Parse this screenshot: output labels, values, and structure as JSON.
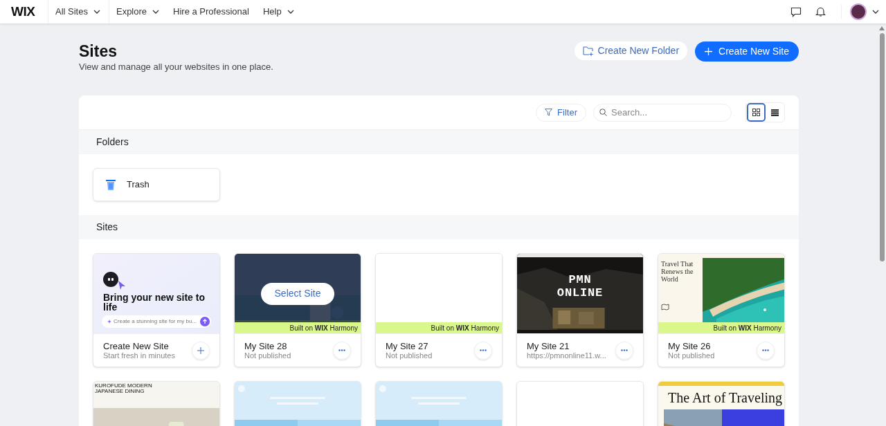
{
  "topbar": {
    "logo": "WIX",
    "nav": [
      {
        "label": "All Sites",
        "dropdown": true
      },
      {
        "label": "Explore",
        "dropdown": true
      },
      {
        "label": "Hire a Professional",
        "dropdown": false
      },
      {
        "label": "Help",
        "dropdown": true
      }
    ]
  },
  "header": {
    "title": "Sites",
    "subtitle": "View and manage all your websites in one place.",
    "buttons": [
      {
        "label": "Create New Folder",
        "kind": "secondary"
      },
      {
        "label": "Create New Site",
        "kind": "primary"
      }
    ]
  },
  "toolbar": {
    "filter": "Filter",
    "search": {
      "placeholder": "Search..."
    },
    "views": [
      {
        "kind": "grid",
        "selected": true
      },
      {
        "kind": "list",
        "selected": false
      }
    ]
  },
  "folders": {
    "heading": "Folders",
    "items": [
      {
        "name": "Trash"
      }
    ]
  },
  "sites": {
    "heading": "Sites",
    "cards": [
      {
        "kind": "create",
        "headline": "Bring your new site to life",
        "prompt": "Create a stunning site for my bu...",
        "name": "Create New Site",
        "status": "Start fresh in minutes"
      },
      {
        "kind": "coast",
        "harmony": "Built on **WIX** Harmony",
        "hover": "Select Site",
        "name": "My Site 28",
        "status": "Not published"
      },
      {
        "kind": "blank",
        "harmony": "Built on **WIX** Harmony",
        "name": "My Site 27",
        "status": "Not published"
      },
      {
        "kind": "dark",
        "headline": "PMN ONLINE",
        "name": "My Site 21",
        "status": "https://pmnonline11.w..."
      },
      {
        "kind": "travel",
        "headline": "Travel That Renews the World",
        "harmony": "Built on **WIX** Harmony",
        "name": "My Site 26",
        "status": "Not published"
      },
      {
        "kind": "dining",
        "headline": "KUROFUDE MODERN JAPANESE DINING"
      },
      {
        "kind": "sky"
      },
      {
        "kind": "sky"
      },
      {
        "kind": "blank"
      },
      {
        "kind": "art",
        "headline": "The Art of Traveling"
      }
    ]
  }
}
